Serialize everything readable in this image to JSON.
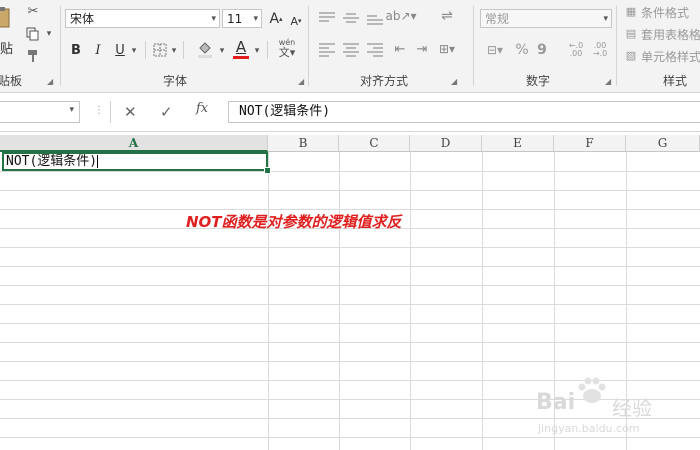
{
  "ribbon": {
    "clipboard": {
      "paste_label": "贴",
      "group_label": "贴板"
    },
    "font": {
      "font_name": "宋体",
      "font_size": "11",
      "grow_label": "A",
      "shrink_label": "A",
      "bold": "B",
      "italic": "I",
      "underline": "U",
      "font_color_glyph": "A",
      "phonetic_label": "wén",
      "group_label": "字体",
      "font_color": "#e11d1d"
    },
    "alignment": {
      "group_label": "对齐方式"
    },
    "number": {
      "format": "常规",
      "percent": "%",
      "comma": "9",
      "group_label": "数字"
    },
    "styles": {
      "conditional": "条件格式",
      "table": "套用表格格",
      "cell": "单元格样式",
      "group_label": "样式"
    }
  },
  "formula_bar": {
    "cancel": "✕",
    "enter": "✓",
    "fx": "fx",
    "content": "NOT(逻辑条件)"
  },
  "grid": {
    "columns": [
      "A",
      "B",
      "C",
      "D",
      "E",
      "F",
      "G"
    ],
    "active_column": "A",
    "active_cell_value": "NOT(逻辑条件)",
    "accent_color": "#217346"
  },
  "annotation": {
    "text": "NOT函数是对参数的逻辑值求反",
    "color": "#e02020"
  },
  "watermark": {
    "brand": "Bai",
    "brand_suffix": "经验",
    "url": "jingyan.baidu.com"
  }
}
